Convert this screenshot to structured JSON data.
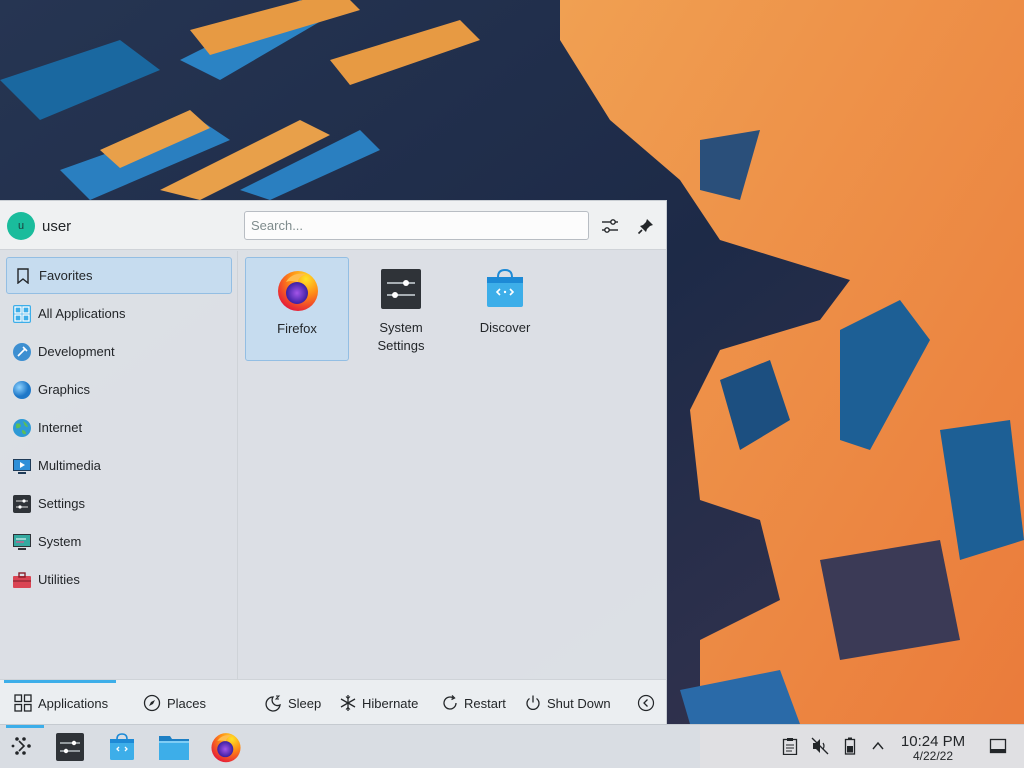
{
  "wallpaper": {
    "name": "desktop-wallpaper"
  },
  "launcher": {
    "user": {
      "name": "user",
      "avatar_initial": "u"
    },
    "search": {
      "placeholder": "Search..."
    },
    "header_buttons": {
      "configure_icon": "sliders-icon",
      "pin_icon": "pin-icon"
    },
    "categories": [
      {
        "label": "Favorites",
        "icon": "bookmark-icon",
        "active": true
      },
      {
        "label": "All Applications",
        "icon": "grid-icon"
      },
      {
        "label": "Development",
        "icon": "development-icon"
      },
      {
        "label": "Graphics",
        "icon": "graphics-icon"
      },
      {
        "label": "Internet",
        "icon": "globe-icon"
      },
      {
        "label": "Multimedia",
        "icon": "multimedia-icon"
      },
      {
        "label": "Settings",
        "icon": "settings-icon"
      },
      {
        "label": "System",
        "icon": "system-icon"
      },
      {
        "label": "Utilities",
        "icon": "toolbox-icon"
      }
    ],
    "apps": [
      {
        "label": "Firefox",
        "icon": "firefox-icon",
        "selected": true
      },
      {
        "label_line1": "System",
        "label_line2": "Settings",
        "icon": "system-settings-icon"
      },
      {
        "label": "Discover",
        "icon": "discover-icon"
      }
    ],
    "footer": {
      "tabs": [
        {
          "label": "Applications",
          "icon": "grid-icon",
          "active": true
        },
        {
          "label": "Places",
          "icon": "compass-icon"
        }
      ],
      "actions": [
        {
          "label": "Sleep",
          "icon": "sleep-icon"
        },
        {
          "label": "Hibernate",
          "icon": "snowflake-icon"
        },
        {
          "label": "Restart",
          "icon": "restart-icon"
        },
        {
          "label": "Shut Down",
          "icon": "power-icon"
        }
      ],
      "more_icon": "chevron-left-icon"
    }
  },
  "taskbar": {
    "items": [
      {
        "name": "application-launcher",
        "icon": "kde-launcher-icon",
        "active": true
      },
      {
        "name": "system-settings",
        "icon": "system-settings-icon"
      },
      {
        "name": "discover",
        "icon": "discover-icon"
      },
      {
        "name": "dolphin-file-manager",
        "icon": "folder-icon"
      },
      {
        "name": "firefox",
        "icon": "firefox-icon"
      }
    ],
    "tray": [
      "clipboard-icon",
      "volume-muted-icon",
      "battery-icon",
      "chevron-up-icon"
    ],
    "clock": {
      "time": "10:24 PM",
      "date": "4/22/22"
    },
    "show_desktop_icon": "show-desktop-icon"
  }
}
